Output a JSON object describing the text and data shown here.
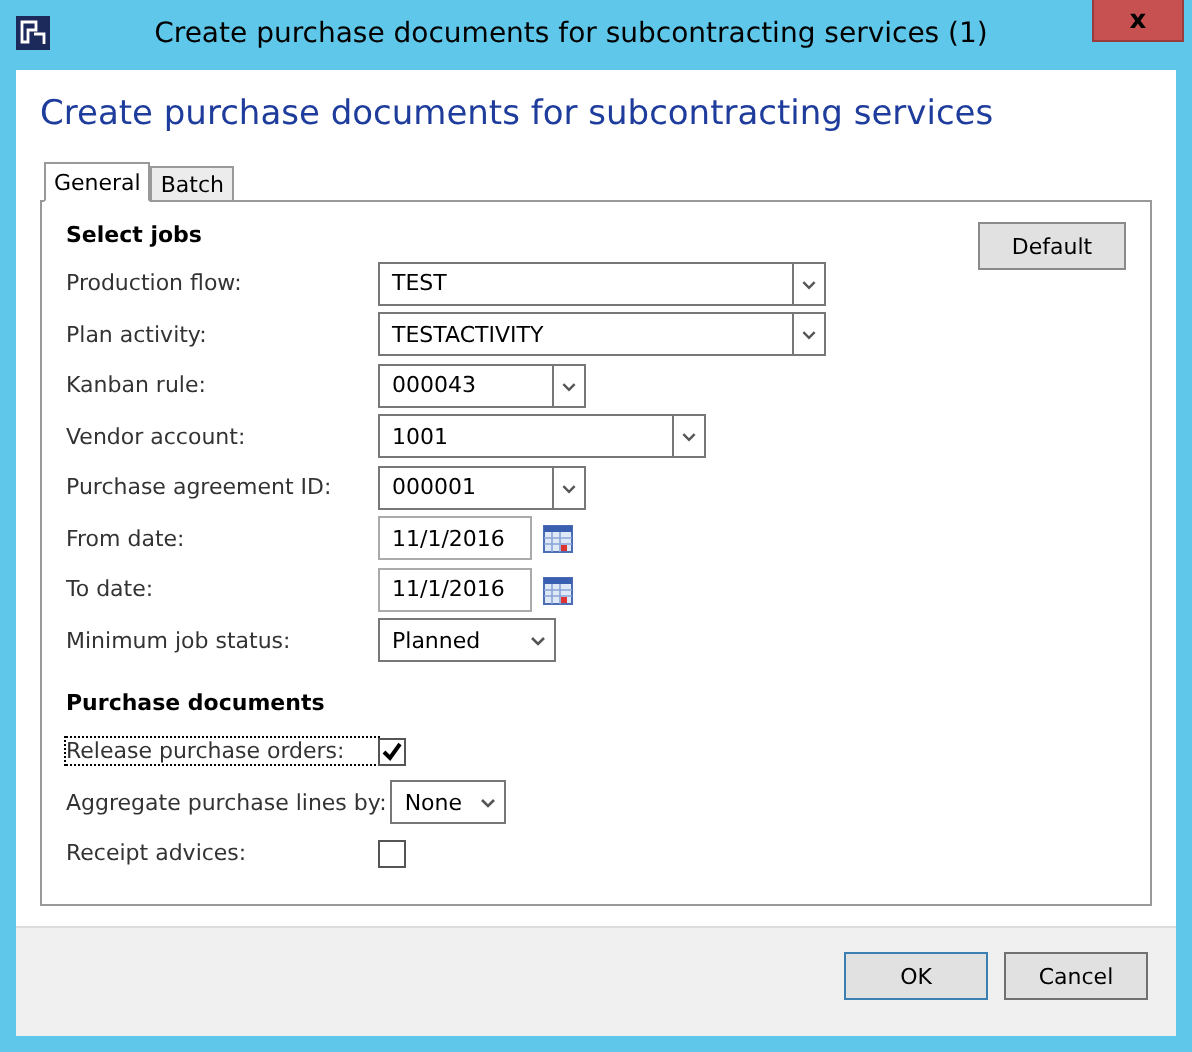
{
  "window": {
    "title": "Create purchase documents for subcontracting services (1)",
    "close": "x"
  },
  "heading": "Create purchase documents for subcontracting services",
  "tabs": [
    {
      "label": "General",
      "selected": true
    },
    {
      "label": "Batch",
      "selected": false
    }
  ],
  "default_button": "Default",
  "select_jobs": {
    "title": "Select jobs",
    "fields": [
      {
        "kind": "combo",
        "label": "Production flow:",
        "value": "TEST"
      },
      {
        "kind": "combo",
        "label": "Plan activity:",
        "value": "TESTACTIVITY"
      },
      {
        "kind": "combo",
        "label": "Kanban rule:",
        "value": "000043"
      },
      {
        "kind": "combo",
        "label": "Vendor account:",
        "value": "1001"
      },
      {
        "kind": "combo",
        "label": "Purchase agreement ID:",
        "value": "000001"
      },
      {
        "kind": "date",
        "label": "From date:",
        "value": "11/1/2016"
      },
      {
        "kind": "date",
        "label": "To date:",
        "value": "11/1/2016"
      },
      {
        "kind": "select",
        "label": "Minimum job status:",
        "value": "Planned"
      }
    ]
  },
  "purchase_documents": {
    "title": "Purchase documents",
    "fields": [
      {
        "kind": "checkbox",
        "label": "Release purchase orders:",
        "checked": true,
        "focused": true
      },
      {
        "kind": "select",
        "label": "Aggregate purchase lines by:",
        "value": "None"
      },
      {
        "kind": "checkbox",
        "label": "Receipt advices:",
        "checked": false,
        "focused": false
      }
    ]
  },
  "buttons": [
    {
      "label": "OK",
      "default": true
    },
    {
      "label": "Cancel",
      "default": false
    }
  ]
}
